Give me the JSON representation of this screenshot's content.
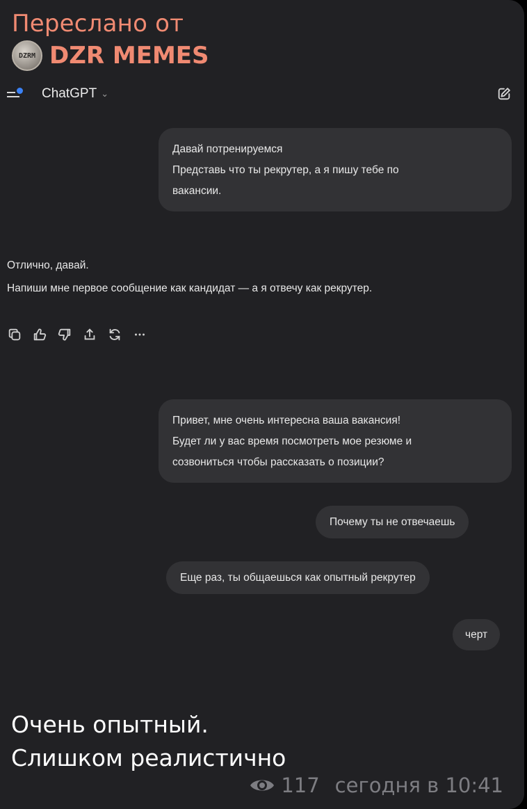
{
  "forward": {
    "label": "Переслано от",
    "channel": "DZR MEMES",
    "avatar_text": "DZRM"
  },
  "chatgpt": {
    "title": "ChatGPT",
    "chevron": "⌄",
    "messages": {
      "user1": [
        "Давай потренируемся",
        "Представь что ты рекрутер, а я пишу тебе по",
        "вакансии."
      ],
      "assistant1": [
        "Отлично, давай.",
        "Напиши мне первое сообщение как кандидат — а я отвечу как рекрутер."
      ],
      "user2": [
        "Привет, мне очень интересна ваша вакансия!",
        "Будет ли у вас время посмотреть мое резюме и",
        "созвониться чтобы рассказать о позиции?"
      ],
      "user3": "Почему ты не отвечаешь",
      "user4": "Еще раз, ты общаешься как опытный рекрутер",
      "user5": "черт"
    },
    "actions": [
      "copy-icon",
      "thumbs-up-icon",
      "thumbs-down-icon",
      "share-icon",
      "regenerate-icon",
      "more-icon"
    ]
  },
  "caption": {
    "line1": "Очень опытный.",
    "line2": "Слишком реалистично"
  },
  "meta": {
    "views": "117",
    "time": "сегодня в 10:41"
  },
  "colors": {
    "accent": "#f08a72",
    "background": "#212124",
    "bubble": "#323235",
    "meta": "#7d7d82",
    "dot": "#3b82f6"
  }
}
